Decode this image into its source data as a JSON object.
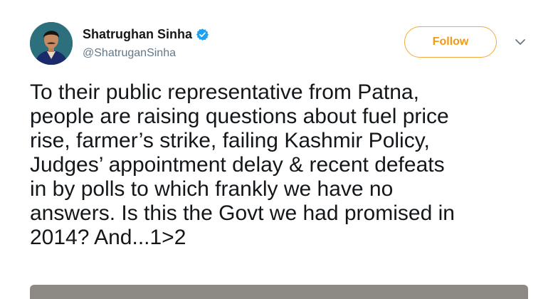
{
  "tweet": {
    "author": {
      "name": "Shatrughan Sinha",
      "handle": "@ShatruganSinha",
      "verified": true
    },
    "follow_label": "Follow",
    "text": "To their public representative from Patna,\npeople are raising questions about fuel price\nrise, farmer’s strike, failing Kashmir Policy,\nJudges’ appointment delay & recent defeats\nin by polls to which frankly we have no\nanswers. Is this the Govt we had promised in\n2014? And...1>2"
  },
  "colors": {
    "accent": "#f4a93a",
    "verified_badge": "#1da1f2",
    "secondary_text": "#657786"
  },
  "icons": {
    "verified": "verified-badge-icon",
    "menu": "chevron-down-icon"
  }
}
